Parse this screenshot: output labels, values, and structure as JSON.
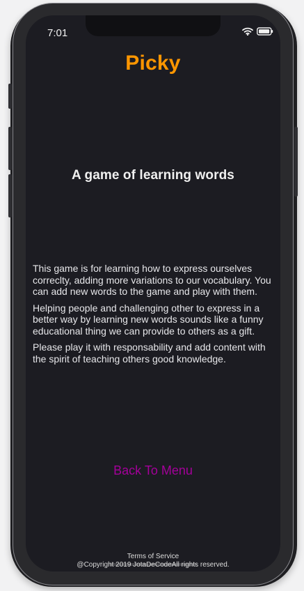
{
  "status_bar": {
    "time": "7:01",
    "wifi_icon": "wifi-icon",
    "battery_icon": "battery-icon"
  },
  "app": {
    "title": "Picky",
    "subtitle": "A game of learning words",
    "description": [
      "This game is for learning how to express ourselves correclty, adding more variations to our vocabulary. You can add new words to the game and play with them.",
      "Helping people and challenging other to express in a better way by learning new words sounds like a funny educational thing we can provide to others as a gift.",
      "Please play it with responsability and add content with the spirit of teaching others good knowledge."
    ],
    "back_link": "Back To Menu"
  },
  "footer": {
    "terms": "Terms of Service",
    "copyright": "@Copyright 2019 JotaDeCodeAll rights reserved."
  },
  "colors": {
    "background": "#1c1c22",
    "title": "#ff9600",
    "text": "#e7e7ea",
    "link": "#a4009a"
  }
}
